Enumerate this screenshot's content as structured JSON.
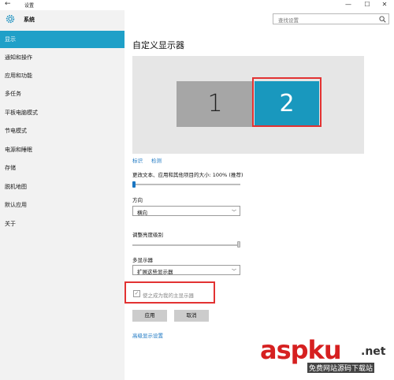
{
  "window": {
    "back_glyph": "←",
    "title": "设置",
    "minimize_glyph": "—",
    "maximize_glyph": "☐",
    "close_glyph": "✕"
  },
  "nav": {
    "header": "系统",
    "items": [
      {
        "label": "显示",
        "active": true
      },
      {
        "label": "通知和操作",
        "active": false
      },
      {
        "label": "应用和功能",
        "active": false
      },
      {
        "label": "多任务",
        "active": false
      },
      {
        "label": "平板电脑模式",
        "active": false
      },
      {
        "label": "节电模式",
        "active": false
      },
      {
        "label": "电源和睡眠",
        "active": false
      },
      {
        "label": "存储",
        "active": false
      },
      {
        "label": "脱机地图",
        "active": false
      },
      {
        "label": "默认应用",
        "active": false
      },
      {
        "label": "关于",
        "active": false
      }
    ]
  },
  "search": {
    "placeholder": "查找设置",
    "icon": "search-icon"
  },
  "main": {
    "title": "自定义显示器",
    "monitors": [
      {
        "number": "1",
        "selected": false
      },
      {
        "number": "2",
        "selected": true
      }
    ],
    "identify_link": "标识",
    "detect_link": "检测",
    "scale_label": "更改文本、应用和其他项目的大小: 100% (推荐)",
    "scale_slider_value": 0,
    "orientation_label": "方向",
    "orientation_value": "横向",
    "brightness_label": "调整亮度级别",
    "brightness_slider_value": 100,
    "multi_display_label": "多显示器",
    "multi_display_value": "扩展这些显示器",
    "make_main_label": "使之成为我的主显示器",
    "make_main_checked": true,
    "apply_button": "应用",
    "cancel_button": "取消",
    "advanced_link": "高级显示设置"
  },
  "watermark": {
    "text": "aspku",
    "suffix": ".net",
    "subtext": "免费网站源码下载站"
  },
  "colors": {
    "accent": "#1fa0c8",
    "selected_monitor": "#1998be",
    "highlight_box": "#e23232",
    "link": "#1a76c2"
  }
}
